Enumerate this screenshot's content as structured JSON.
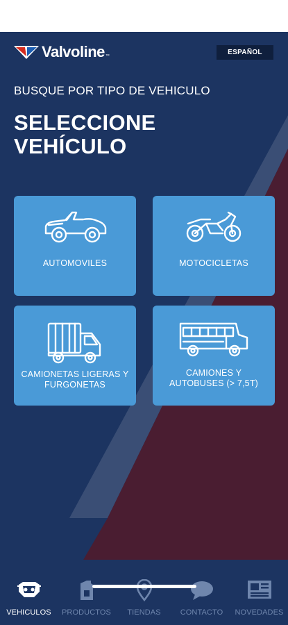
{
  "app": {
    "brand": "Valvoline",
    "brand_tm": "™",
    "language_button": "ESPAÑOL"
  },
  "page": {
    "subtitle": "BUSQUE POR TIPO DE VEHICULO",
    "title": "SELECCIONE VEHÍCULO"
  },
  "vehicles": [
    {
      "label": "AUTOMOVILES",
      "icon": "car-icon"
    },
    {
      "label": "MOTOCICLETAS",
      "icon": "motorcycle-icon"
    },
    {
      "label": "CAMIONETAS LIGERAS Y FURGONETAS",
      "icon": "van-truck-icon"
    },
    {
      "label": "CAMIONES Y AUTOBUSES (> 7,5T)",
      "icon": "bus-icon"
    }
  ],
  "tabs": [
    {
      "label": "VEHICULOS",
      "icon": "vehicle-engine-icon",
      "active": true
    },
    {
      "label": "PRODUCTOS",
      "icon": "oil-can-icon",
      "active": false
    },
    {
      "label": "TIENDAS",
      "icon": "location-pin-icon",
      "active": false
    },
    {
      "label": "CONTACTO",
      "icon": "chat-bubble-icon",
      "active": false
    },
    {
      "label": "NOVEDADES",
      "icon": "newspaper-icon",
      "active": false
    }
  ],
  "colors": {
    "navy": "#1c3461",
    "maroon": "#4d1c2e",
    "card_blue": "#4a9ad7",
    "logo_red": "#d52b1e",
    "logo_blue": "#1d5fb4",
    "tab_inactive": "#6f86ad"
  }
}
